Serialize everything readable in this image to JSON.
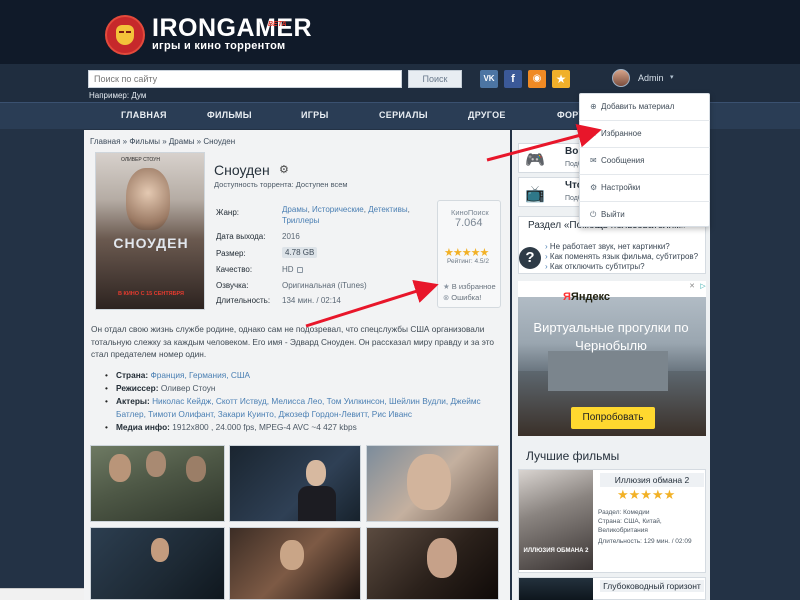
{
  "site": {
    "logo_title": "IRONGAMER",
    "logo_beta": "BETA",
    "logo_subtitle": "игры и кино торрентом"
  },
  "search": {
    "placeholder": "Поиск по сайту",
    "button_label": "Поиск",
    "hint": "Например: Дум"
  },
  "social": {
    "vk": "VK",
    "fb": "f",
    "rss": "◉",
    "star": "★"
  },
  "user": {
    "name": "Admin",
    "caret": "▾"
  },
  "nav": [
    "ГЛАВНАЯ",
    "ФИЛЬМЫ",
    "ИГРЫ",
    "СЕРИАЛЫ",
    "ДРУГОЕ",
    "ФОРУМ"
  ],
  "breadcrumb": "Главная » Фильмы » Драмы » Сноуден",
  "film": {
    "poster_author": "ОЛИВЕР СТОУН",
    "poster_title": "СНОУДЕН",
    "poster_date": "В КИНО С 15 СЕНТЯБРЯ",
    "title": "Сноуден",
    "availability": "Доступность торрента: Доступен всем",
    "details": {
      "genre_label": "Жанр:",
      "genre_1": "Драмы",
      "genre_2": "Исторические",
      "genre_3": "Детективы",
      "genre_4": "Триллеры",
      "release_label": "Дата выхода:",
      "release_value": "2016",
      "size_label": "Размер:",
      "size_value": "4.78 GB",
      "quality_label": "Качество:",
      "quality_value": "HD",
      "voice_label": "Озвучка:",
      "voice_value": "Оригинальная (iTunes)",
      "duration_label": "Длительность:",
      "duration_value": "134 мин. / 02:14"
    },
    "rating_box": {
      "label": "КиноПоиск",
      "value": "7.064",
      "stars": 4.5,
      "stars_text": "★★★★★",
      "rating_text": "Рейтинг: 4.5/2",
      "fav_label": "В избранное",
      "error_label": "Ошибка!"
    },
    "description": "Он отдал свою жизнь службе родине, однако сам не подозревал, что спецслужбы США организовали тотальную слежку за каждым человеком. Его имя - Эдвард Сноуден. Он рассказал миру правду и за это стал предателем номер один.",
    "facts": {
      "country_label": "Страна:",
      "country_value": "Франция, Германия, США",
      "director_label": "Режиссер:",
      "director_value": "Оливер Стоун",
      "actors_label": "Актеры:",
      "actors_value": "Николас Кейдж, Скотт Иствуд, Мелисса Лео, Том Уилкинсон, Шейлин Вудли, Джеймс Батлер, Тимоти Олифант, Закари Куинто, Джозеф Гордон-Левитт, Рис Иванс",
      "media_label": "Медиа инфо:",
      "media_value": "1912x800 , 24.000 fps, MPEG-4 AVC ~4 427 kbps"
    }
  },
  "sidebar": {
    "tile_1": {
      "title": "Во что",
      "sub": "Подбор"
    },
    "tile_2": {
      "title": "Что по",
      "sub": "Подбор"
    },
    "help": {
      "title": "Раздел «Помощь пользователям»",
      "q1": "Не работает звук, нет картинки?",
      "q2": "Как поменять язык фильма, субтитров?",
      "q3": "Как отключить субтитры?"
    },
    "ad": {
      "logo": "Яндекс",
      "title": "Виртуальные прогулки по Чернобылю",
      "button": "Попробовать"
    },
    "best": {
      "heading": "Лучшие фильмы",
      "film_1": {
        "name": "Иллюзия обмана 2",
        "stars": 5,
        "stars_text": "★★★★★",
        "poster_caption": "ИЛЛЮЗИЯ ОБМАНА 2",
        "genre": "Раздел: Комедии",
        "country_1": "Страна: США, Китай,",
        "country_2": "Великобритания",
        "duration": "Длительность: 129 мин. / 02:09"
      },
      "film_2": {
        "name": "Глубоководный горизонт"
      }
    }
  },
  "dropdown": {
    "items": [
      "Добавить материал",
      "Избранное",
      "Сообщения",
      "Настройки",
      "Выйти"
    ]
  },
  "colors": {
    "accent_link": "#4a7fb3",
    "star": "#f2b126",
    "arrow": "#e8162a",
    "header_bg": "#101a29"
  }
}
